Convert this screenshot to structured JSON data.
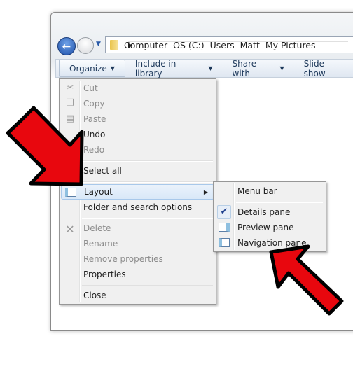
{
  "nav": {
    "back_icon": "back-arrow-icon",
    "forward_icon": "forward-arrow-icon"
  },
  "address": {
    "crumbs": [
      "Computer",
      "OS (C:)",
      "Users",
      "Matt",
      "My Pictures"
    ]
  },
  "toolbar": {
    "organize": "Organize",
    "include": "Include in library",
    "share": "Share with",
    "slideshow": "Slide show"
  },
  "menu": {
    "cut": "Cut",
    "copy": "Copy",
    "paste": "Paste",
    "undo": "Undo",
    "redo": "Redo",
    "select_all": "Select all",
    "layout": "Layout",
    "folder_options": "Folder and search options",
    "delete": "Delete",
    "rename": "Rename",
    "remove_properties": "Remove properties",
    "properties": "Properties",
    "close": "Close"
  },
  "submenu": {
    "menu_bar": "Menu bar",
    "details_pane": "Details pane",
    "details_checked": true,
    "preview_pane": "Preview pane",
    "navigation_pane": "Navigation pane"
  },
  "colors": {
    "arrow": "#e8070e",
    "highlight": "#d9e8f8"
  }
}
